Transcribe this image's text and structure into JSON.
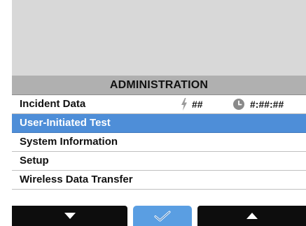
{
  "menu": {
    "title": "ADMINISTRATION",
    "items": [
      {
        "label": "Incident Data",
        "shock_count": "##",
        "elapsed_time": "#:##:##"
      },
      {
        "label": "User-Initiated Test"
      },
      {
        "label": "System Information"
      },
      {
        "label": "Setup"
      },
      {
        "label": "Wireless Data Transfer"
      }
    ],
    "selected_index": 1
  },
  "softkeys": {
    "left_icon": "triangle-down-icon",
    "center_icon": "checkmark-icon",
    "right_icon": "triangle-up-icon"
  },
  "colors": {
    "header_bg": "#b0b0b0",
    "selected_bg": "#4e8ed8",
    "softkey_bg": "#0d0d0d",
    "softkey_center_bg": "#5a9ee2",
    "top_area_bg": "#d8d8d8"
  },
  "icons": {
    "shock": "lightning-bolt-icon",
    "time": "clock-icon"
  }
}
